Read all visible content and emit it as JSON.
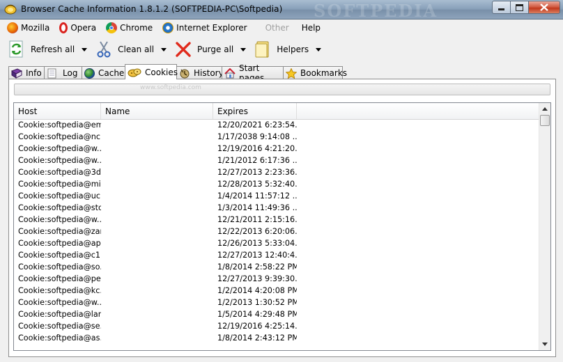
{
  "window": {
    "title": "Browser Cache Information 1.8.1.2 (SOFTPEDIA-PC\\Softpedia)",
    "watermark": "SOFTPEDIA"
  },
  "menu": [
    {
      "label": "Mozilla",
      "icon": "firefox-icon"
    },
    {
      "label": "Opera",
      "icon": "opera-icon"
    },
    {
      "label": "Chrome",
      "icon": "chrome-icon"
    },
    {
      "label": "Internet Explorer",
      "icon": "ie-icon"
    },
    {
      "label": "Other",
      "icon": "",
      "disabled": true
    },
    {
      "label": "Help",
      "icon": ""
    }
  ],
  "toolbar": {
    "refresh_label": "Refresh all",
    "clean_label": "Clean all",
    "purge_label": "Purge all",
    "helpers_label": "Helpers"
  },
  "tabs": [
    {
      "label": "Info"
    },
    {
      "label": "Log"
    },
    {
      "label": "Cache"
    },
    {
      "label": "Cookies"
    },
    {
      "label": "History"
    },
    {
      "label": "Start pages"
    },
    {
      "label": "Bookmarks"
    }
  ],
  "panel_watermark": "www.softpedia.com",
  "columns": {
    "host": "Host",
    "name": "Name",
    "expires": "Expires"
  },
  "rows": [
    {
      "host": "Cookie:softpedia@em...",
      "name": "",
      "expires": "12/20/2021 6:23:54..."
    },
    {
      "host": "Cookie:softpedia@nc...",
      "name": "",
      "expires": "1/17/2038 9:14:08 ..."
    },
    {
      "host": "Cookie:softpedia@w...",
      "name": "",
      "expires": "12/19/2016 4:21:20..."
    },
    {
      "host": "Cookie:softpedia@w...",
      "name": "",
      "expires": "1/21/2012 6:17:36 ..."
    },
    {
      "host": "Cookie:softpedia@3d...",
      "name": "",
      "expires": "12/27/2013 2:23:36..."
    },
    {
      "host": "Cookie:softpedia@mi...",
      "name": "",
      "expires": "12/28/2013 5:32:40..."
    },
    {
      "host": "Cookie:softpedia@uc...",
      "name": "",
      "expires": "1/4/2014 11:57:12 ..."
    },
    {
      "host": "Cookie:softpedia@sto...",
      "name": "",
      "expires": "1/3/2014 11:49:36 ..."
    },
    {
      "host": "Cookie:softpedia@w...",
      "name": "",
      "expires": "12/21/2011 2:15:16..."
    },
    {
      "host": "Cookie:softpedia@zar...",
      "name": "",
      "expires": "12/22/2013 6:20:06..."
    },
    {
      "host": "Cookie:softpedia@ap...",
      "name": "",
      "expires": "12/26/2013 5:33:04..."
    },
    {
      "host": "Cookie:softpedia@c1...",
      "name": "",
      "expires": "12/27/2013 12:40:4..."
    },
    {
      "host": "Cookie:softpedia@so...",
      "name": "",
      "expires": "1/8/2014 2:58:22 PM"
    },
    {
      "host": "Cookie:softpedia@pe...",
      "name": "",
      "expires": "12/27/2013 9:39:30..."
    },
    {
      "host": "Cookie:softpedia@kc...",
      "name": "",
      "expires": "1/2/2014 4:20:08 PM"
    },
    {
      "host": "Cookie:softpedia@w...",
      "name": "",
      "expires": "1/2/2013 1:30:52 PM"
    },
    {
      "host": "Cookie:softpedia@lan...",
      "name": "",
      "expires": "1/5/2014 4:29:48 PM"
    },
    {
      "host": "Cookie:softpedia@se...",
      "name": "",
      "expires": "12/19/2016 4:25:14..."
    },
    {
      "host": "Cookie:softpedia@as...",
      "name": "",
      "expires": "1/8/2014 2:43:12 PM"
    }
  ]
}
